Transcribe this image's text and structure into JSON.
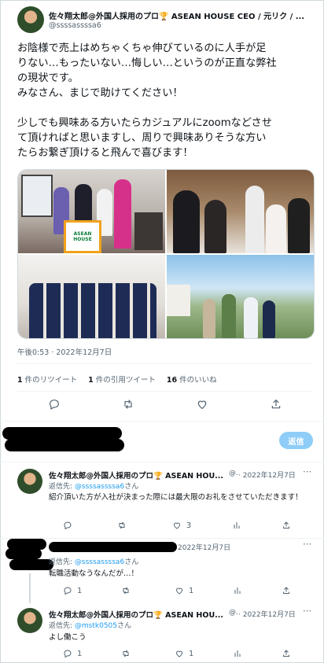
{
  "main_tweet": {
    "author_name": "佐々翔太郎@外国人採用のプロ🏆 ASEAN HOUSE CEO / 元リク / ...",
    "handle": "@ssssassssa6",
    "body_lines": [
      "お陰様で売上はめちゃくちゃ伸びているのに人手が足",
      "りない…もったいない…悔しい…というのが正直な弊社",
      "の現状です。",
      "みなさん、まじで助けてください！",
      "",
      "少しでも興味ある方いたらカジュアルにzoomなどさせ",
      "て頂ければと思いますし、周りで興味ありそうな方い",
      "たらお繋ぎ頂けると飛んで喜びます！"
    ],
    "timestamp": "午後0:53 · 2022年12月7日",
    "photo_banner_text": "ASEAN HOUSE",
    "stats": [
      {
        "count": "1",
        "label": "件のリツイート"
      },
      {
        "count": "1",
        "label": "件の引用ツイート"
      },
      {
        "count": "16",
        "label": "件のいいね"
      }
    ]
  },
  "reply_box": {
    "button_label": "返信"
  },
  "replies": [
    {
      "author_name": "佐々翔太郎@外国人採用のプロ🏆 ASEAN HOU...",
      "handle": "@.",
      "date": "· 2022年12月7日",
      "reply_to_prefix": "返信先: ",
      "reply_to_handle": "@ssssassssa6",
      "reply_to_suffix": "さん",
      "body": "紹介頂いた方が入社が決まった際には最大限のお礼をさせていただきます！",
      "reply_count": "",
      "retweet_count": "",
      "like_count": "3"
    },
    {
      "date": "2022年12月7日",
      "reply_to_prefix": "返信先: ",
      "reply_to_handle": "@ssssassssa6",
      "reply_to_suffix": "さん",
      "body": "転職活動なうなんだが…！",
      "reply_count": "1",
      "retweet_count": "",
      "like_count": "1"
    },
    {
      "author_name": "佐々翔太郎@外国人採用のプロ🏆 ASEAN HOU...",
      "handle": "@.",
      "date": "· 2022年12月7日",
      "reply_to_prefix": "返信先: ",
      "reply_to_handle": "@mstk0505",
      "reply_to_suffix": "さん",
      "body": "よし働こう",
      "reply_count": "1",
      "retweet_count": "",
      "like_count": "1"
    }
  ]
}
